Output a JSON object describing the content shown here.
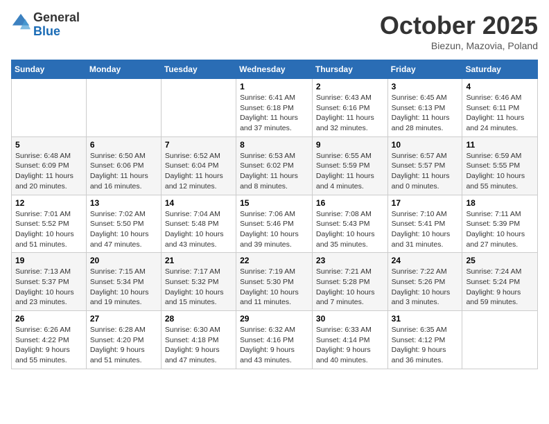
{
  "header": {
    "logo_general": "General",
    "logo_blue": "Blue",
    "month_title": "October 2025",
    "location": "Biezun, Mazovia, Poland"
  },
  "calendar": {
    "days_of_week": [
      "Sunday",
      "Monday",
      "Tuesday",
      "Wednesday",
      "Thursday",
      "Friday",
      "Saturday"
    ],
    "weeks": [
      [
        {
          "day": "",
          "info": ""
        },
        {
          "day": "",
          "info": ""
        },
        {
          "day": "",
          "info": ""
        },
        {
          "day": "1",
          "info": "Sunrise: 6:41 AM\nSunset: 6:18 PM\nDaylight: 11 hours\nand 37 minutes."
        },
        {
          "day": "2",
          "info": "Sunrise: 6:43 AM\nSunset: 6:16 PM\nDaylight: 11 hours\nand 32 minutes."
        },
        {
          "day": "3",
          "info": "Sunrise: 6:45 AM\nSunset: 6:13 PM\nDaylight: 11 hours\nand 28 minutes."
        },
        {
          "day": "4",
          "info": "Sunrise: 6:46 AM\nSunset: 6:11 PM\nDaylight: 11 hours\nand 24 minutes."
        }
      ],
      [
        {
          "day": "5",
          "info": "Sunrise: 6:48 AM\nSunset: 6:09 PM\nDaylight: 11 hours\nand 20 minutes."
        },
        {
          "day": "6",
          "info": "Sunrise: 6:50 AM\nSunset: 6:06 PM\nDaylight: 11 hours\nand 16 minutes."
        },
        {
          "day": "7",
          "info": "Sunrise: 6:52 AM\nSunset: 6:04 PM\nDaylight: 11 hours\nand 12 minutes."
        },
        {
          "day": "8",
          "info": "Sunrise: 6:53 AM\nSunset: 6:02 PM\nDaylight: 11 hours\nand 8 minutes."
        },
        {
          "day": "9",
          "info": "Sunrise: 6:55 AM\nSunset: 5:59 PM\nDaylight: 11 hours\nand 4 minutes."
        },
        {
          "day": "10",
          "info": "Sunrise: 6:57 AM\nSunset: 5:57 PM\nDaylight: 11 hours\nand 0 minutes."
        },
        {
          "day": "11",
          "info": "Sunrise: 6:59 AM\nSunset: 5:55 PM\nDaylight: 10 hours\nand 55 minutes."
        }
      ],
      [
        {
          "day": "12",
          "info": "Sunrise: 7:01 AM\nSunset: 5:52 PM\nDaylight: 10 hours\nand 51 minutes."
        },
        {
          "day": "13",
          "info": "Sunrise: 7:02 AM\nSunset: 5:50 PM\nDaylight: 10 hours\nand 47 minutes."
        },
        {
          "day": "14",
          "info": "Sunrise: 7:04 AM\nSunset: 5:48 PM\nDaylight: 10 hours\nand 43 minutes."
        },
        {
          "day": "15",
          "info": "Sunrise: 7:06 AM\nSunset: 5:46 PM\nDaylight: 10 hours\nand 39 minutes."
        },
        {
          "day": "16",
          "info": "Sunrise: 7:08 AM\nSunset: 5:43 PM\nDaylight: 10 hours\nand 35 minutes."
        },
        {
          "day": "17",
          "info": "Sunrise: 7:10 AM\nSunset: 5:41 PM\nDaylight: 10 hours\nand 31 minutes."
        },
        {
          "day": "18",
          "info": "Sunrise: 7:11 AM\nSunset: 5:39 PM\nDaylight: 10 hours\nand 27 minutes."
        }
      ],
      [
        {
          "day": "19",
          "info": "Sunrise: 7:13 AM\nSunset: 5:37 PM\nDaylight: 10 hours\nand 23 minutes."
        },
        {
          "day": "20",
          "info": "Sunrise: 7:15 AM\nSunset: 5:34 PM\nDaylight: 10 hours\nand 19 minutes."
        },
        {
          "day": "21",
          "info": "Sunrise: 7:17 AM\nSunset: 5:32 PM\nDaylight: 10 hours\nand 15 minutes."
        },
        {
          "day": "22",
          "info": "Sunrise: 7:19 AM\nSunset: 5:30 PM\nDaylight: 10 hours\nand 11 minutes."
        },
        {
          "day": "23",
          "info": "Sunrise: 7:21 AM\nSunset: 5:28 PM\nDaylight: 10 hours\nand 7 minutes."
        },
        {
          "day": "24",
          "info": "Sunrise: 7:22 AM\nSunset: 5:26 PM\nDaylight: 10 hours\nand 3 minutes."
        },
        {
          "day": "25",
          "info": "Sunrise: 7:24 AM\nSunset: 5:24 PM\nDaylight: 9 hours\nand 59 minutes."
        }
      ],
      [
        {
          "day": "26",
          "info": "Sunrise: 6:26 AM\nSunset: 4:22 PM\nDaylight: 9 hours\nand 55 minutes."
        },
        {
          "day": "27",
          "info": "Sunrise: 6:28 AM\nSunset: 4:20 PM\nDaylight: 9 hours\nand 51 minutes."
        },
        {
          "day": "28",
          "info": "Sunrise: 6:30 AM\nSunset: 4:18 PM\nDaylight: 9 hours\nand 47 minutes."
        },
        {
          "day": "29",
          "info": "Sunrise: 6:32 AM\nSunset: 4:16 PM\nDaylight: 9 hours\nand 43 minutes."
        },
        {
          "day": "30",
          "info": "Sunrise: 6:33 AM\nSunset: 4:14 PM\nDaylight: 9 hours\nand 40 minutes."
        },
        {
          "day": "31",
          "info": "Sunrise: 6:35 AM\nSunset: 4:12 PM\nDaylight: 9 hours\nand 36 minutes."
        },
        {
          "day": "",
          "info": ""
        }
      ]
    ]
  }
}
